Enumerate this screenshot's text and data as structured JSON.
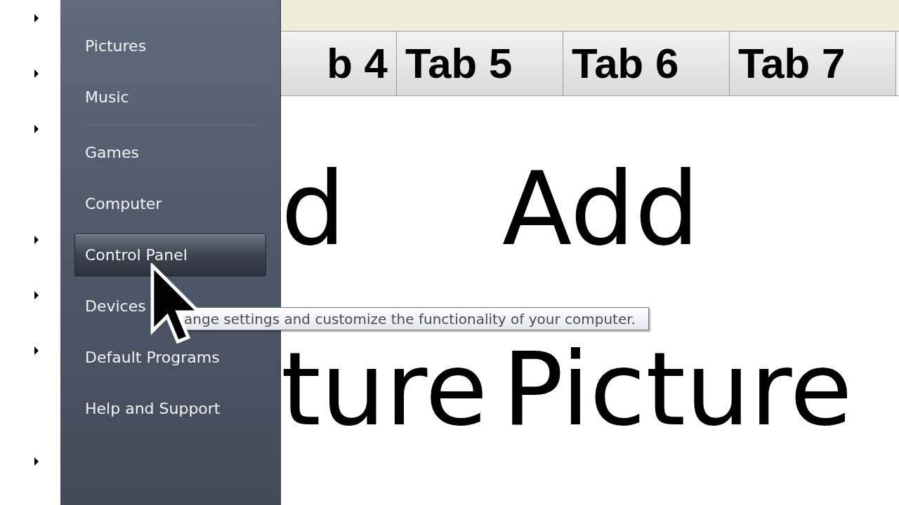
{
  "start_menu": {
    "items": [
      {
        "kind": "item",
        "label": "Pictures",
        "selected": false
      },
      {
        "kind": "item",
        "label": "Music",
        "selected": false
      },
      {
        "kind": "separator"
      },
      {
        "kind": "item",
        "label": "Games",
        "selected": false
      },
      {
        "kind": "item",
        "label": "Computer",
        "selected": false
      },
      {
        "kind": "item",
        "label": "Control Panel",
        "selected": true
      },
      {
        "kind": "item",
        "label": "Devices",
        "selected": false
      },
      {
        "kind": "item",
        "label": "Default Programs",
        "selected": false
      },
      {
        "kind": "item",
        "label": "Help and Support",
        "selected": false
      }
    ]
  },
  "tooltip": {
    "text": "ange settings and customize the functionality of your computer."
  },
  "tabs": [
    {
      "label": "b 4",
      "selected": false
    },
    {
      "label": "Tab 5",
      "selected": false
    },
    {
      "label": "Tab 6",
      "selected": false
    },
    {
      "label": "Tab 7",
      "selected": false
    }
  ],
  "content": {
    "rows": [
      [
        "d",
        "Add"
      ],
      [
        "ture",
        "Picture"
      ]
    ]
  }
}
